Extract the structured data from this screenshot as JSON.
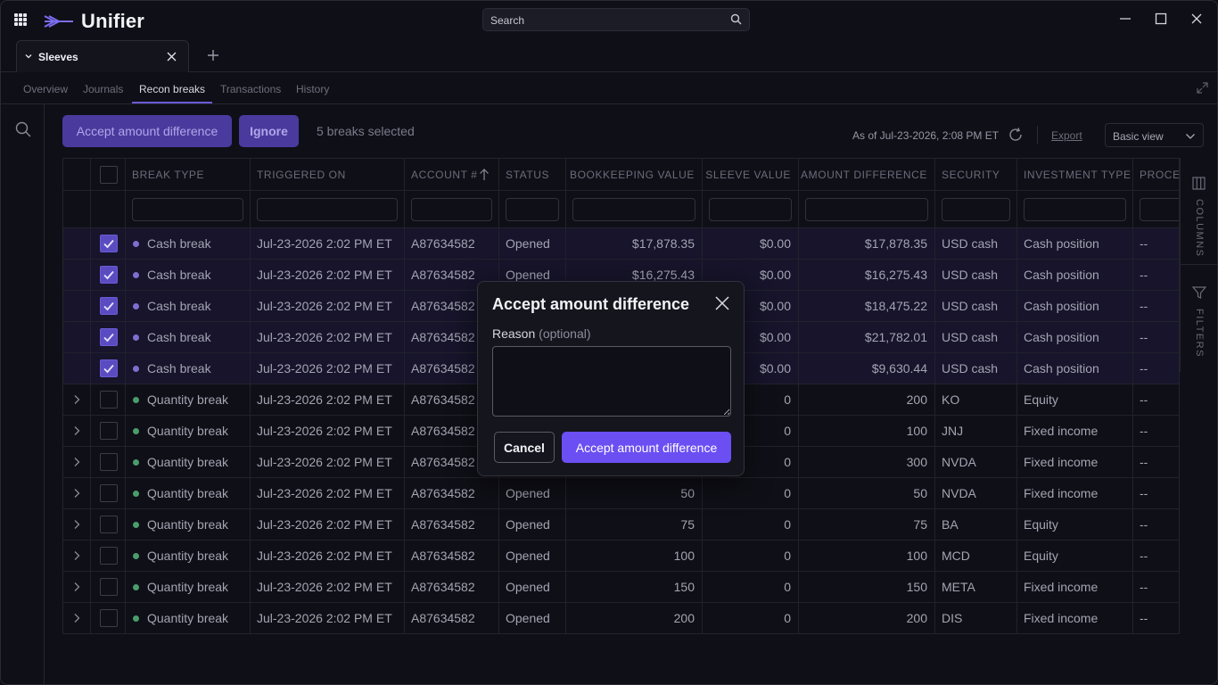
{
  "app": {
    "name": "Unifier"
  },
  "search": {
    "placeholder": "Search"
  },
  "doc_tab": {
    "label": "Sleeves"
  },
  "subtabs": [
    "Overview",
    "Journals",
    "Recon breaks",
    "Transactions",
    "History"
  ],
  "active_subtab": "Recon breaks",
  "toolbar": {
    "accept_label": "Accept amount difference",
    "ignore_label": "Ignore",
    "selection_text": "5 breaks selected",
    "as_of": "As of Jul-23-2026, 2:08 PM ET",
    "export_label": "Export",
    "view_select": "Basic view"
  },
  "side_rail": {
    "columns_label": "COLUMNS",
    "filters_label": "FILTERS"
  },
  "table": {
    "headers": [
      "BREAK TYPE",
      "TRIGGERED ON",
      "ACCOUNT #",
      "STATUS",
      "BOOKKEEPING VALUE",
      "SLEEVE VALUE",
      "AMOUNT DIFFERENCE",
      "SECURITY",
      "INVESTMENT TYPE",
      "PROCES"
    ],
    "rows": [
      {
        "selected": true,
        "expandable": false,
        "type": "cash",
        "cells": [
          "Cash break",
          "Jul-23-2026 2:02 PM ET",
          "A87634582",
          "Opened",
          "$17,878.35",
          "$0.00",
          "$17,878.35",
          "USD cash",
          "Cash position",
          "--"
        ]
      },
      {
        "selected": true,
        "expandable": false,
        "type": "cash",
        "cells": [
          "Cash break",
          "Jul-23-2026 2:02 PM ET",
          "A87634582",
          "Opened",
          "$16,275.43",
          "$0.00",
          "$16,275.43",
          "USD cash",
          "Cash position",
          "--"
        ]
      },
      {
        "selected": true,
        "expandable": false,
        "type": "cash",
        "cells": [
          "Cash break",
          "Jul-23-2026 2:02 PM ET",
          "A87634582",
          "",
          "",
          "$0.00",
          "$18,475.22",
          "USD cash",
          "Cash position",
          "--"
        ]
      },
      {
        "selected": true,
        "expandable": false,
        "type": "cash",
        "cells": [
          "Cash break",
          "Jul-23-2026 2:02 PM ET",
          "A87634582",
          "",
          "",
          "$0.00",
          "$21,782.01",
          "USD cash",
          "Cash position",
          "--"
        ]
      },
      {
        "selected": true,
        "expandable": false,
        "type": "cash",
        "cells": [
          "Cash break",
          "Jul-23-2026 2:02 PM ET",
          "A87634582",
          "",
          "",
          "$0.00",
          "$9,630.44",
          "USD cash",
          "Cash position",
          "--"
        ]
      },
      {
        "selected": false,
        "expandable": true,
        "type": "qty",
        "cells": [
          "Quantity break",
          "Jul-23-2026 2:02 PM ET",
          "A87634582",
          "",
          "",
          "0",
          "200",
          "KO",
          "Equity",
          "--"
        ]
      },
      {
        "selected": false,
        "expandable": true,
        "type": "qty",
        "cells": [
          "Quantity break",
          "Jul-23-2026 2:02 PM ET",
          "A87634582",
          "",
          "",
          "0",
          "100",
          "JNJ",
          "Fixed income",
          "--"
        ]
      },
      {
        "selected": false,
        "expandable": true,
        "type": "qty",
        "cells": [
          "Quantity break",
          "Jul-23-2026 2:02 PM ET",
          "A87634582",
          "",
          "",
          "0",
          "300",
          "NVDA",
          "Fixed income",
          "--"
        ]
      },
      {
        "selected": false,
        "expandable": true,
        "type": "qty",
        "cells": [
          "Quantity break",
          "Jul-23-2026 2:02 PM ET",
          "A87634582",
          "Opened",
          "50",
          "0",
          "50",
          "NVDA",
          "Fixed income",
          "--"
        ]
      },
      {
        "selected": false,
        "expandable": true,
        "type": "qty",
        "cells": [
          "Quantity break",
          "Jul-23-2026 2:02 PM ET",
          "A87634582",
          "Opened",
          "75",
          "0",
          "75",
          "BA",
          "Equity",
          "--"
        ]
      },
      {
        "selected": false,
        "expandable": true,
        "type": "qty",
        "cells": [
          "Quantity break",
          "Jul-23-2026 2:02 PM ET",
          "A87634582",
          "Opened",
          "100",
          "0",
          "100",
          "MCD",
          "Equity",
          "--"
        ]
      },
      {
        "selected": false,
        "expandable": true,
        "type": "qty",
        "cells": [
          "Quantity break",
          "Jul-23-2026 2:02 PM ET",
          "A87634582",
          "Opened",
          "150",
          "0",
          "150",
          "META",
          "Fixed income",
          "--"
        ]
      },
      {
        "selected": false,
        "expandable": true,
        "type": "qty",
        "cells": [
          "Quantity break",
          "Jul-23-2026 2:02 PM ET",
          "A87634582",
          "Opened",
          "200",
          "0",
          "200",
          "DIS",
          "Fixed income",
          "--"
        ]
      }
    ]
  },
  "modal": {
    "title": "Accept amount difference",
    "reason_label": "Reason",
    "reason_optional": "(optional)",
    "reason_value": "",
    "cancel_label": "Cancel",
    "confirm_label": "Accept amount difference"
  },
  "colors": {
    "accent": "#6b4ff2",
    "accent_muted": "#4a3a9e",
    "background": "#0f0f17",
    "cash_dot": "#7d6fcf",
    "qty_dot": "#4a9d6b"
  }
}
